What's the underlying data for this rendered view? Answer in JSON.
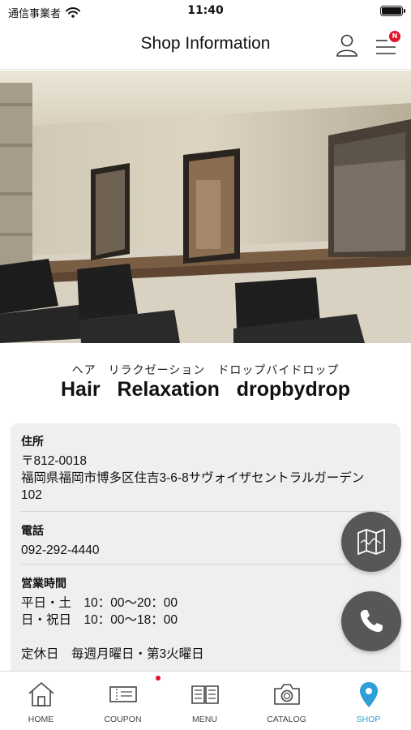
{
  "status_bar": {
    "carrier": "通信事業者",
    "time": "11:40"
  },
  "header": {
    "title": "Shop Information",
    "menu_badge": "N"
  },
  "shop": {
    "name_kana": "ヘア　リラクゼーション　ドロップバイドロップ",
    "name": "Hair   Relaxation   dropbydrop"
  },
  "info": {
    "address_label": "住所",
    "address": "〒812-0018\n福岡県福岡市博多区住吉3-6-8サヴォイザセントラルガーデン\n102",
    "phone_label": "電話",
    "phone": "092-292-4440",
    "hours_label": "営業時間",
    "hours": "平日・土　10：00〜20：00\n日・祝日　10：00〜18：00",
    "closed": "定休日　毎週月曜日・第3火曜日"
  },
  "tabs": [
    {
      "label": "HOME",
      "icon": "home-icon"
    },
    {
      "label": "COUPON",
      "icon": "coupon-icon"
    },
    {
      "label": "MENU",
      "icon": "menu-book-icon"
    },
    {
      "label": "CATALOG",
      "icon": "camera-icon"
    },
    {
      "label": "SHOP",
      "icon": "location-pin-icon"
    }
  ],
  "colors": {
    "accent": "#2f9fd8",
    "badge": "#e0142d",
    "fab": "#575757",
    "card": "#efefef"
  }
}
